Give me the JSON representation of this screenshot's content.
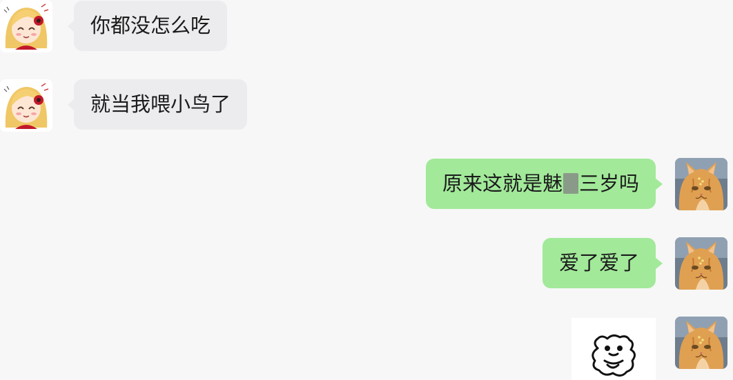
{
  "messages": [
    {
      "side": "left",
      "avatar": "anime-girl-avatar",
      "text": "你都没怎么吃"
    },
    {
      "side": "left",
      "avatar": "anime-girl-avatar",
      "text": "就当我喂小鸟了"
    },
    {
      "side": "right",
      "avatar": "orange-cat-avatar",
      "text_before": "原来这就是魅",
      "redacted": true,
      "text_after": "三岁吗"
    },
    {
      "side": "right",
      "avatar": "orange-cat-avatar",
      "text": "爱了爱了"
    },
    {
      "side": "right",
      "avatar": "orange-cat-avatar",
      "type": "sticker",
      "sticker": "cartoon-bear-sticker"
    }
  ],
  "colors": {
    "background": "#f7f7f7",
    "left_bubble": "#ececef",
    "right_bubble": "#a2e99a",
    "text": "#1b1b1b"
  }
}
